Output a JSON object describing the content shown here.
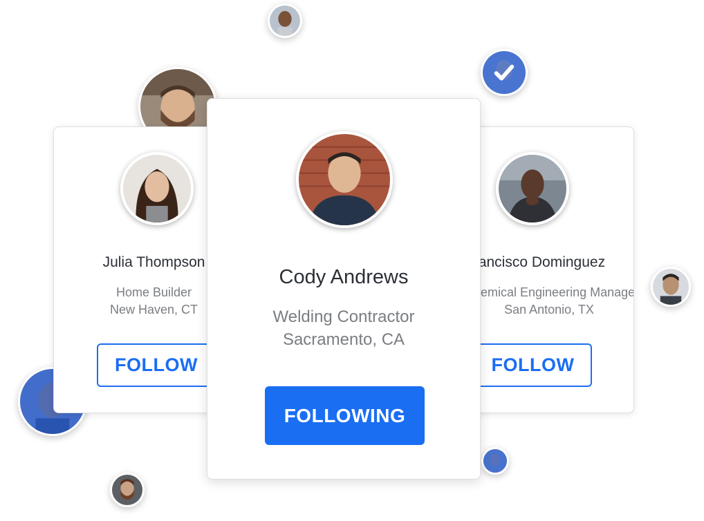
{
  "cards": {
    "left": {
      "name": "Julia Thompson",
      "role": "Home Builder",
      "location": "New Haven, CT",
      "button_label": "FOLLOW"
    },
    "center": {
      "name": "Cody Andrews",
      "role": "Welding Contractor",
      "location": "Sacramento, CA",
      "button_label": "FOLLOWING"
    },
    "right": {
      "name": "Francisco Dominguez",
      "role": "Chemical Engineering Manager",
      "location": "San Antonio, TX",
      "button_label": "FOLLOW"
    }
  },
  "icons": {
    "verified": "check-icon"
  },
  "colors": {
    "accent": "#1a6ef2",
    "name_text": "#2b2f36",
    "sub_text": "#7a7d82"
  }
}
